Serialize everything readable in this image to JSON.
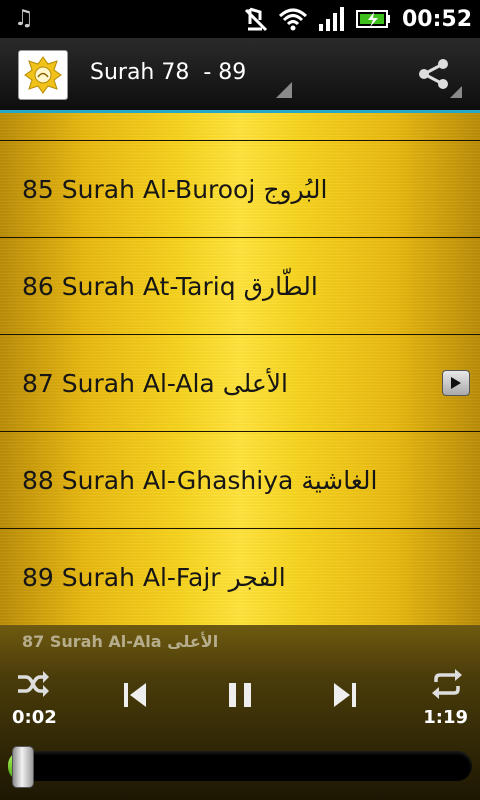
{
  "status_bar": {
    "time": "00:52",
    "icons": [
      "music-note-icon",
      "mute-icon",
      "wifi-icon",
      "signal-icon",
      "battery-charging-icon"
    ]
  },
  "action_bar": {
    "title": "Surah 78  - 89",
    "icons": [
      "app-logo-icon",
      "share-icon"
    ]
  },
  "list": {
    "items": [
      {
        "label": "85 Surah Al-Burooj",
        "arabic": "البُروج"
      },
      {
        "label": "86 Surah At-Tariq",
        "arabic": "الطّارق"
      },
      {
        "label": "87 Surah Al-Ala",
        "arabic": "الأعلى",
        "playing": true
      },
      {
        "label": "88 Surah Al-Ghashiya",
        "arabic": "الغاشية"
      },
      {
        "label": "89 Surah Al-Fajr",
        "arabic": "الفجر"
      }
    ]
  },
  "player": {
    "now_playing": "87 Surah Al-Ala",
    "now_playing_arabic": "الأعلى",
    "elapsed": "0:02",
    "duration": "1:19",
    "progress_fraction": 0.025,
    "controls": [
      "shuffle-icon",
      "previous-icon",
      "pause-icon",
      "next-icon",
      "repeat-icon"
    ]
  },
  "colors": {
    "accent": "#28a8c8",
    "gold": "#f6d31c",
    "seek_green": "#6fd01c"
  }
}
